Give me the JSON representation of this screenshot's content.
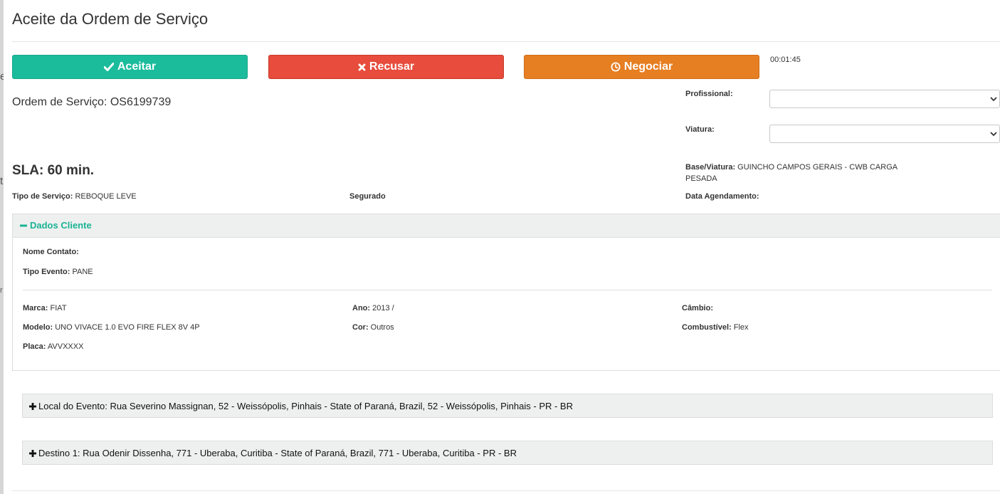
{
  "modal": {
    "title": "Aceite da Ordem de Serviço"
  },
  "actions": {
    "accept_label": "Aceitar",
    "refuse_label": "Recusar",
    "negotiate_label": "Negociar",
    "timer": "00:01:45"
  },
  "order": {
    "number_text": "Ordem de Serviço: OS6199739",
    "sla": "SLA: 60 min.",
    "tipo_servico_label": "Tipo de Serviço:",
    "tipo_servico_value": "REBOQUE LEVE",
    "segurado_label": "Segurado",
    "data_agendamento_label": "Data Agendamento:"
  },
  "assignment": {
    "profissional_label": "Profissional:",
    "profissional_value": "",
    "viatura_label": "Viatura:",
    "viatura_value": "",
    "base_viatura_label": "Base/Viatura:",
    "base_viatura_value": "GUINCHO CAMPOS GERAIS - CWB CARGA PESADA"
  },
  "cliente": {
    "heading": "Dados Cliente",
    "nome_contato_label": "Nome Contato:",
    "nome_contato_value": "",
    "tipo_evento_label": "Tipo Evento:",
    "tipo_evento_value": "PANE",
    "marca_label": "Marca:",
    "marca_value": "FIAT",
    "modelo_label": "Modelo:",
    "modelo_value": "UNO VIVACE 1.0 EVO FIRE FLEX 8V 4P",
    "placa_label": "Placa:",
    "placa_value": "AVVXXXX",
    "ano_label": "Ano:",
    "ano_value": "2013 /",
    "cor_label": "Cor:",
    "cor_value": "Outros",
    "cambio_label": "Câmbio:",
    "cambio_value": "",
    "combustivel_label": "Combustível:",
    "combustivel_value": "Flex"
  },
  "locations": {
    "evento": "Local do Evento: Rua Severino Massignan, 52 - Weissópolis, Pinhais - State of Paraná, Brazil, 52 - Weissópolis, Pinhais - PR - BR",
    "destino": "Destino 1: Rua Odenir Dissenha, 771 - Uberaba, Curitiba - State of Paraná, Brazil, 771 - Uberaba, Curitiba - PR - BR"
  },
  "background": {
    "frag1": "e",
    "frag2": "t",
    "frag3": "r"
  },
  "colors": {
    "accept": "#1abc9c",
    "refuse": "#e74c3c",
    "negotiate": "#e67e22",
    "panel_heading_text": "#1ab394"
  },
  "icons": {
    "accept": "check-icon",
    "refuse": "times-icon",
    "negotiate": "clock-icon",
    "panel_toggle": "minus-icon",
    "expand": "plus-icon",
    "select": "chevron-down-icon"
  }
}
